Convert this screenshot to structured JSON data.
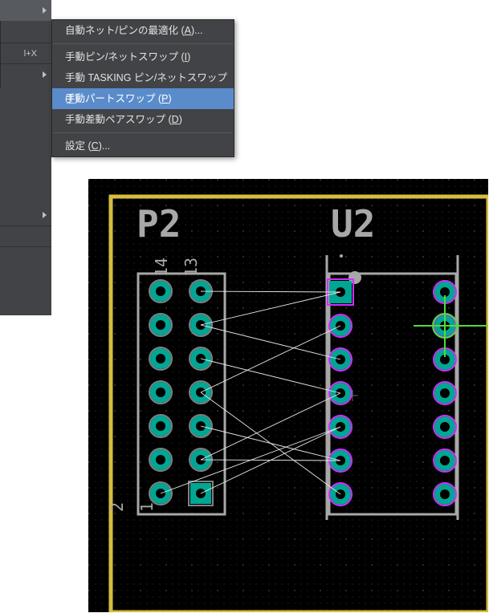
{
  "parent_menu": {
    "shortcut": "l+X"
  },
  "menu": {
    "items": [
      {
        "label": "自動ネット/ピンの最適化 ",
        "accel_letter": "A",
        "accel_suffix": "..."
      },
      {
        "label": "手動ピン/ネットスワップ ",
        "accel_letter": "I",
        "accel_suffix": ""
      },
      {
        "label": "手動 TASKING ピン/ネットスワップ ",
        "accel_letter": "T",
        "accel_suffix": ""
      },
      {
        "label": "手動パートスワップ ",
        "accel_letter": "P",
        "accel_suffix": "",
        "selected": true
      },
      {
        "label": "手動差動ペアスワップ ",
        "accel_letter": "D",
        "accel_suffix": ""
      },
      {
        "label": "設定 ",
        "accel_letter": "C",
        "accel_suffix": "..."
      }
    ]
  },
  "pcb": {
    "colors": {
      "board_outline": "#d5bd3e",
      "pad_fill": "#00a693",
      "annular": "#d22eff",
      "text": "#a8a8a8",
      "ratsnest": "#e7e7e7",
      "cursor": "#4edc38"
    },
    "refdes": {
      "P2": "P2",
      "U2": "U2"
    },
    "pin_labels": [
      "14",
      "13",
      "2",
      "1"
    ]
  }
}
